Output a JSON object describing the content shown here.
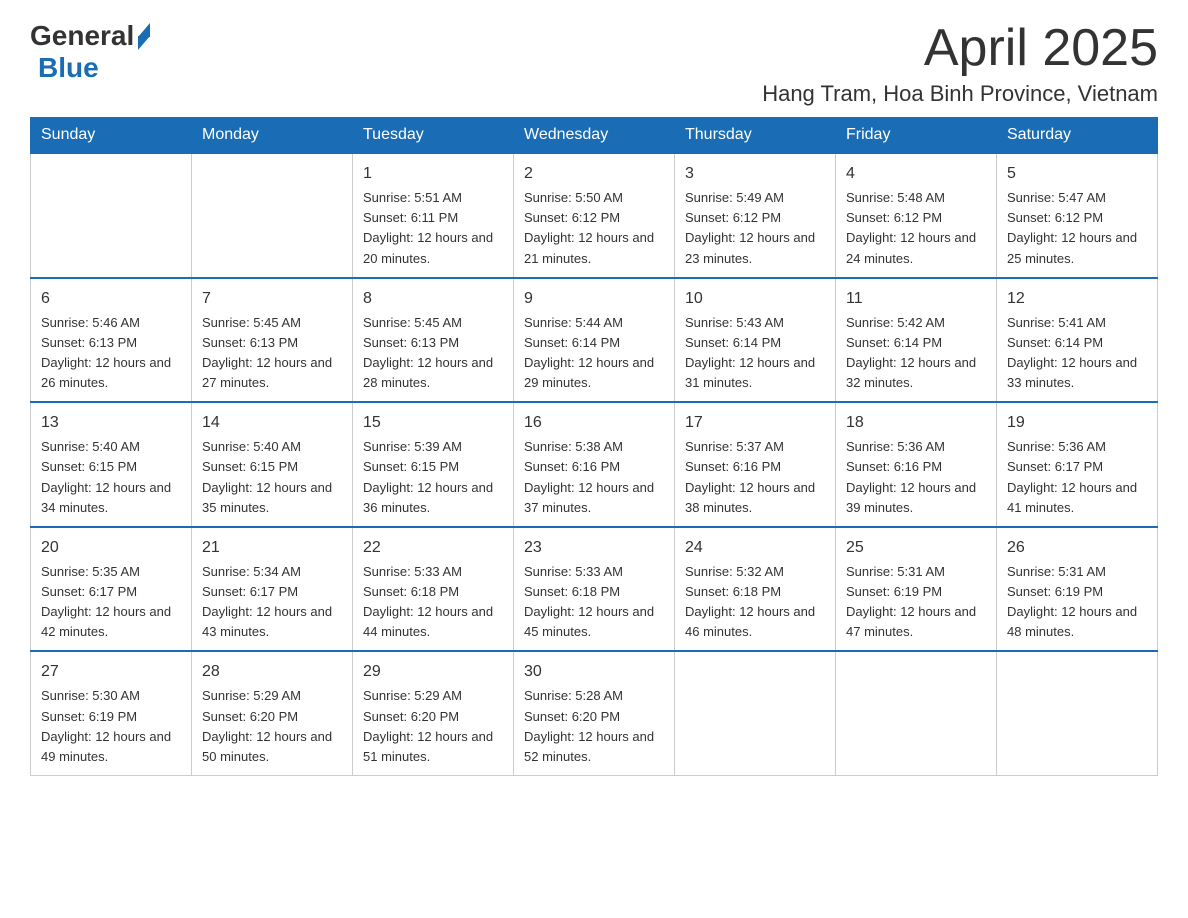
{
  "header": {
    "logo_general": "General",
    "logo_blue": "Blue",
    "month_title": "April 2025",
    "location": "Hang Tram, Hoa Binh Province, Vietnam"
  },
  "days_of_week": [
    "Sunday",
    "Monday",
    "Tuesday",
    "Wednesday",
    "Thursday",
    "Friday",
    "Saturday"
  ],
  "weeks": [
    [
      {
        "day": "",
        "info": ""
      },
      {
        "day": "",
        "info": ""
      },
      {
        "day": "1",
        "info": "Sunrise: 5:51 AM\nSunset: 6:11 PM\nDaylight: 12 hours and 20 minutes."
      },
      {
        "day": "2",
        "info": "Sunrise: 5:50 AM\nSunset: 6:12 PM\nDaylight: 12 hours and 21 minutes."
      },
      {
        "day": "3",
        "info": "Sunrise: 5:49 AM\nSunset: 6:12 PM\nDaylight: 12 hours and 23 minutes."
      },
      {
        "day": "4",
        "info": "Sunrise: 5:48 AM\nSunset: 6:12 PM\nDaylight: 12 hours and 24 minutes."
      },
      {
        "day": "5",
        "info": "Sunrise: 5:47 AM\nSunset: 6:12 PM\nDaylight: 12 hours and 25 minutes."
      }
    ],
    [
      {
        "day": "6",
        "info": "Sunrise: 5:46 AM\nSunset: 6:13 PM\nDaylight: 12 hours and 26 minutes."
      },
      {
        "day": "7",
        "info": "Sunrise: 5:45 AM\nSunset: 6:13 PM\nDaylight: 12 hours and 27 minutes."
      },
      {
        "day": "8",
        "info": "Sunrise: 5:45 AM\nSunset: 6:13 PM\nDaylight: 12 hours and 28 minutes."
      },
      {
        "day": "9",
        "info": "Sunrise: 5:44 AM\nSunset: 6:14 PM\nDaylight: 12 hours and 29 minutes."
      },
      {
        "day": "10",
        "info": "Sunrise: 5:43 AM\nSunset: 6:14 PM\nDaylight: 12 hours and 31 minutes."
      },
      {
        "day": "11",
        "info": "Sunrise: 5:42 AM\nSunset: 6:14 PM\nDaylight: 12 hours and 32 minutes."
      },
      {
        "day": "12",
        "info": "Sunrise: 5:41 AM\nSunset: 6:14 PM\nDaylight: 12 hours and 33 minutes."
      }
    ],
    [
      {
        "day": "13",
        "info": "Sunrise: 5:40 AM\nSunset: 6:15 PM\nDaylight: 12 hours and 34 minutes."
      },
      {
        "day": "14",
        "info": "Sunrise: 5:40 AM\nSunset: 6:15 PM\nDaylight: 12 hours and 35 minutes."
      },
      {
        "day": "15",
        "info": "Sunrise: 5:39 AM\nSunset: 6:15 PM\nDaylight: 12 hours and 36 minutes."
      },
      {
        "day": "16",
        "info": "Sunrise: 5:38 AM\nSunset: 6:16 PM\nDaylight: 12 hours and 37 minutes."
      },
      {
        "day": "17",
        "info": "Sunrise: 5:37 AM\nSunset: 6:16 PM\nDaylight: 12 hours and 38 minutes."
      },
      {
        "day": "18",
        "info": "Sunrise: 5:36 AM\nSunset: 6:16 PM\nDaylight: 12 hours and 39 minutes."
      },
      {
        "day": "19",
        "info": "Sunrise: 5:36 AM\nSunset: 6:17 PM\nDaylight: 12 hours and 41 minutes."
      }
    ],
    [
      {
        "day": "20",
        "info": "Sunrise: 5:35 AM\nSunset: 6:17 PM\nDaylight: 12 hours and 42 minutes."
      },
      {
        "day": "21",
        "info": "Sunrise: 5:34 AM\nSunset: 6:17 PM\nDaylight: 12 hours and 43 minutes."
      },
      {
        "day": "22",
        "info": "Sunrise: 5:33 AM\nSunset: 6:18 PM\nDaylight: 12 hours and 44 minutes."
      },
      {
        "day": "23",
        "info": "Sunrise: 5:33 AM\nSunset: 6:18 PM\nDaylight: 12 hours and 45 minutes."
      },
      {
        "day": "24",
        "info": "Sunrise: 5:32 AM\nSunset: 6:18 PM\nDaylight: 12 hours and 46 minutes."
      },
      {
        "day": "25",
        "info": "Sunrise: 5:31 AM\nSunset: 6:19 PM\nDaylight: 12 hours and 47 minutes."
      },
      {
        "day": "26",
        "info": "Sunrise: 5:31 AM\nSunset: 6:19 PM\nDaylight: 12 hours and 48 minutes."
      }
    ],
    [
      {
        "day": "27",
        "info": "Sunrise: 5:30 AM\nSunset: 6:19 PM\nDaylight: 12 hours and 49 minutes."
      },
      {
        "day": "28",
        "info": "Sunrise: 5:29 AM\nSunset: 6:20 PM\nDaylight: 12 hours and 50 minutes."
      },
      {
        "day": "29",
        "info": "Sunrise: 5:29 AM\nSunset: 6:20 PM\nDaylight: 12 hours and 51 minutes."
      },
      {
        "day": "30",
        "info": "Sunrise: 5:28 AM\nSunset: 6:20 PM\nDaylight: 12 hours and 52 minutes."
      },
      {
        "day": "",
        "info": ""
      },
      {
        "day": "",
        "info": ""
      },
      {
        "day": "",
        "info": ""
      }
    ]
  ]
}
